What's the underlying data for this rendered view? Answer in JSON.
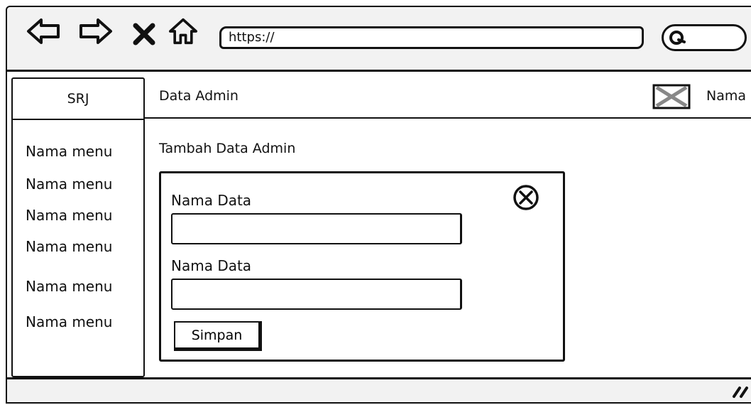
{
  "browser": {
    "url": "https://"
  },
  "sidebar": {
    "brand": "SRJ",
    "items": [
      {
        "label": "Nama menu"
      },
      {
        "label": "Nama menu"
      },
      {
        "label": "Nama menu"
      },
      {
        "label": "Nama menu"
      },
      {
        "label": "Nama menu"
      },
      {
        "label": "Nama menu"
      }
    ]
  },
  "header": {
    "title": "Data Admin",
    "user_name": "Nama"
  },
  "main": {
    "section_title": "Tambah Data Admin",
    "form": {
      "fields": [
        {
          "label": "Nama Data",
          "value": ""
        },
        {
          "label": "Nama Data",
          "value": ""
        }
      ],
      "submit_label": "Simpan"
    }
  },
  "icons": [
    "back-arrow-icon",
    "forward-arrow-icon",
    "close-x-icon",
    "home-icon",
    "search-icon",
    "image-placeholder-icon",
    "close-circle-icon",
    "resize-grip-icon"
  ]
}
